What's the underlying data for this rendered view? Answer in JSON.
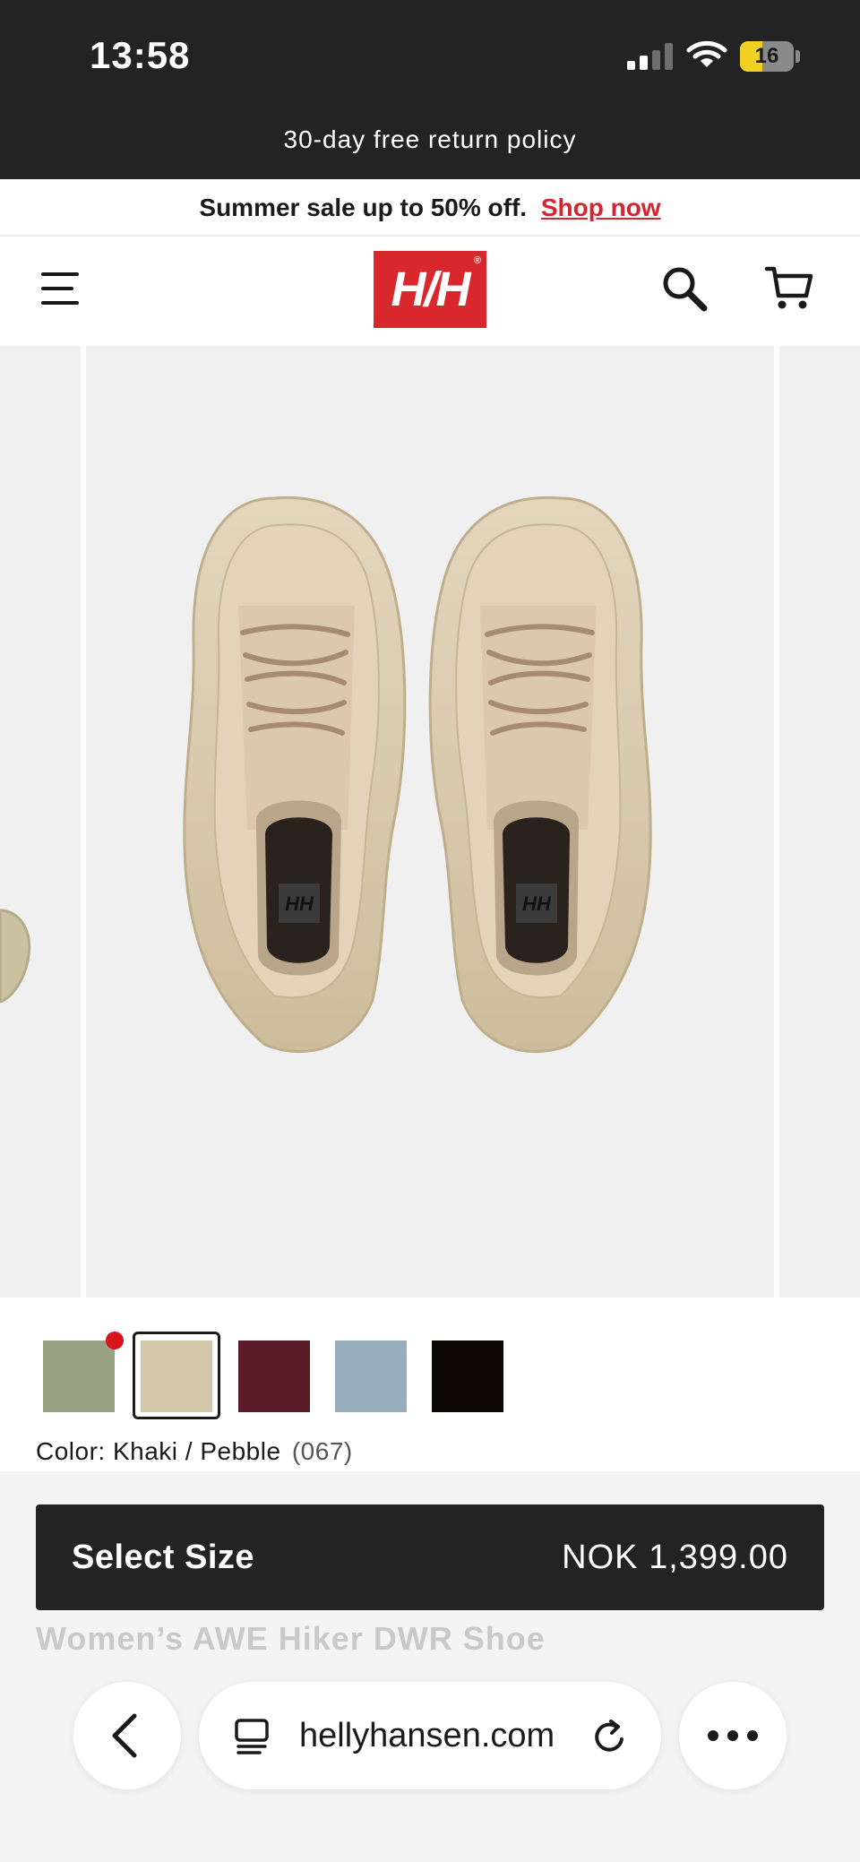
{
  "status_bar": {
    "time": "13:58",
    "battery": "16",
    "battery_level": 0.16
  },
  "banners": {
    "returns": "30-day free return policy",
    "sale_text": "Summer sale up to 50% off.",
    "sale_link": "Shop now"
  },
  "header": {
    "logo": "H/H",
    "icons": [
      "menu-icon",
      "search-icon",
      "cart-icon"
    ]
  },
  "colors": {
    "brand_red": "#d9272e",
    "dark": "#232323",
    "swatches": [
      "#99a383",
      "#d3c8ab",
      "#5a1c27",
      "#96adbd",
      "#0d0806"
    ]
  },
  "product": {
    "color_label": "Color:",
    "color_name": "Khaki / Pebble",
    "color_code": "(067)",
    "name": "Women’s AWE Hiker DWR Shoe",
    "select_size": "Select Size",
    "price": "NOK 1,399.00"
  },
  "browser": {
    "url": "hellyhansen.com"
  }
}
